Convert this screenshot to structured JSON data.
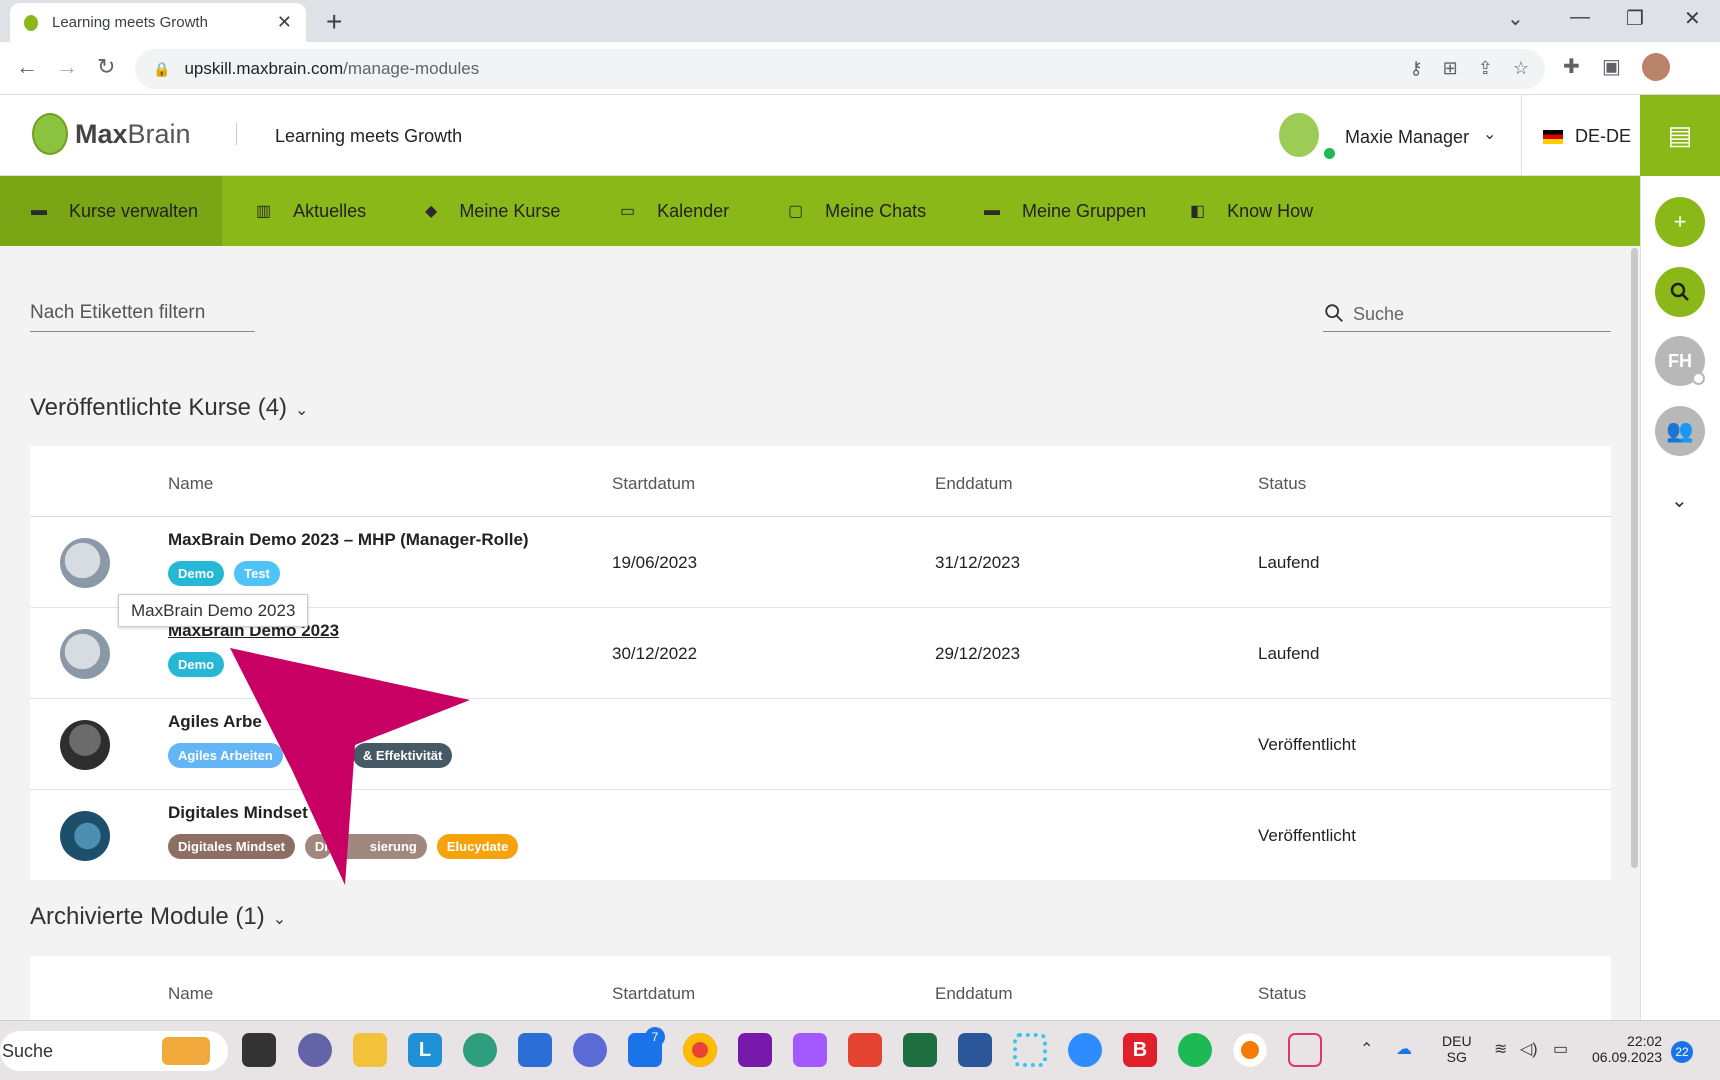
{
  "browser": {
    "tab_title": "Learning meets Growth",
    "url_host": "upskill.maxbrain.com",
    "url_path": "/manage-modules"
  },
  "header": {
    "logo_max": "Max",
    "logo_brain": "Brain",
    "tagline": "Learning meets Growth",
    "user_name": "Maxie Manager",
    "language": "DE-DE"
  },
  "rail": {
    "initials": "FH"
  },
  "nav": {
    "items": [
      {
        "label": "Kurse verwalten"
      },
      {
        "label": "Aktuelles"
      },
      {
        "label": "Meine Kurse"
      },
      {
        "label": "Kalender"
      },
      {
        "label": "Meine Chats"
      },
      {
        "label": "Meine Gruppen"
      },
      {
        "label": "Know How"
      }
    ]
  },
  "filters": {
    "tag_filter_placeholder": "Nach Etiketten filtern",
    "search_placeholder": "Suche"
  },
  "published": {
    "title": "Veröffentlichte Kurse (4)",
    "columns": [
      "Name",
      "Startdatum",
      "Enddatum",
      "Status"
    ],
    "rows": [
      {
        "name": "MaxBrain Demo 2023 – MHP (Manager-Rolle)",
        "tags": [
          {
            "label": "Demo",
            "color": "#26b7d6"
          },
          {
            "label": "Test",
            "color": "#4fc3f7"
          }
        ],
        "start": "19/06/2023",
        "end": "31/12/2023",
        "status": "Laufend"
      },
      {
        "name": "MaxBrain Demo 2023",
        "tags": [
          {
            "label": "Demo",
            "color": "#26b7d6"
          }
        ],
        "start": "30/12/2022",
        "end": "29/12/2023",
        "status": "Laufend"
      },
      {
        "name": "Agiles Arbe",
        "tags": [
          {
            "label": "Agiles Arbeiten",
            "color": "#64b5f6"
          },
          {
            "label": "& Effektivität",
            "color": "#455a64"
          }
        ],
        "start": "",
        "end": "",
        "status": "Veröffentlicht"
      },
      {
        "name": "Digitales Mindset",
        "tags": [
          {
            "label": "Digitales Mindset",
            "color": "#8d6e63"
          },
          {
            "label": "Di",
            "color": "#a1887f"
          },
          {
            "label": "sierung",
            "color": "#a1887f"
          },
          {
            "label": "Elucydate",
            "color": "#f5a20c"
          }
        ],
        "start": "",
        "end": "",
        "status": "Veröffentlicht"
      }
    ]
  },
  "tooltip": "MaxBrain Demo 2023",
  "archived": {
    "title": "Archivierte Module (1)",
    "columns": [
      "Name",
      "Startdatum",
      "Enddatum",
      "Status"
    ]
  },
  "taskbar": {
    "search_label": "Suche",
    "badge": "7",
    "lang_top": "DEU",
    "lang_bottom": "SG",
    "time": "22:02",
    "date": "06.09.2023",
    "notifications": "22"
  },
  "colors": {
    "brand_green": "#8bb819",
    "pointer_magenta": "#c80064"
  }
}
